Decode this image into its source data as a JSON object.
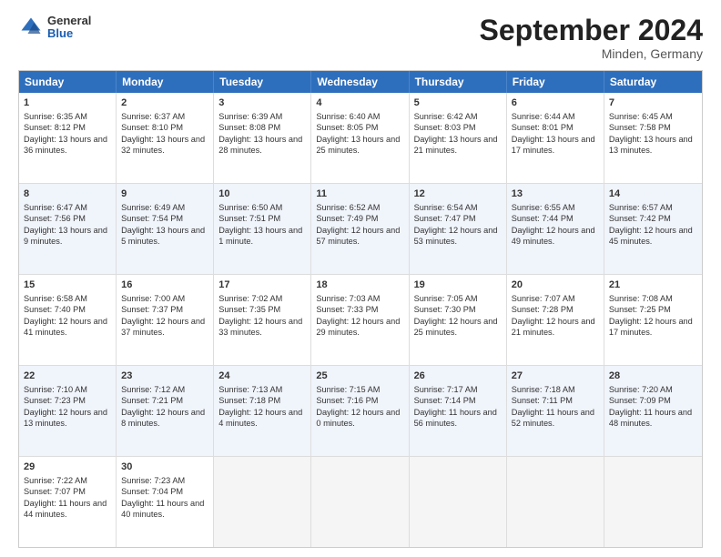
{
  "header": {
    "logo": {
      "general": "General",
      "blue": "Blue"
    },
    "title": "September 2024",
    "location": "Minden, Germany"
  },
  "calendar": {
    "days": [
      "Sunday",
      "Monday",
      "Tuesday",
      "Wednesday",
      "Thursday",
      "Friday",
      "Saturday"
    ],
    "rows": [
      [
        {
          "day": "1",
          "sunrise": "Sunrise: 6:35 AM",
          "sunset": "Sunset: 8:12 PM",
          "daylight": "Daylight: 13 hours and 36 minutes."
        },
        {
          "day": "2",
          "sunrise": "Sunrise: 6:37 AM",
          "sunset": "Sunset: 8:10 PM",
          "daylight": "Daylight: 13 hours and 32 minutes."
        },
        {
          "day": "3",
          "sunrise": "Sunrise: 6:39 AM",
          "sunset": "Sunset: 8:08 PM",
          "daylight": "Daylight: 13 hours and 28 minutes."
        },
        {
          "day": "4",
          "sunrise": "Sunrise: 6:40 AM",
          "sunset": "Sunset: 8:05 PM",
          "daylight": "Daylight: 13 hours and 25 minutes."
        },
        {
          "day": "5",
          "sunrise": "Sunrise: 6:42 AM",
          "sunset": "Sunset: 8:03 PM",
          "daylight": "Daylight: 13 hours and 21 minutes."
        },
        {
          "day": "6",
          "sunrise": "Sunrise: 6:44 AM",
          "sunset": "Sunset: 8:01 PM",
          "daylight": "Daylight: 13 hours and 17 minutes."
        },
        {
          "day": "7",
          "sunrise": "Sunrise: 6:45 AM",
          "sunset": "Sunset: 7:58 PM",
          "daylight": "Daylight: 13 hours and 13 minutes."
        }
      ],
      [
        {
          "day": "8",
          "sunrise": "Sunrise: 6:47 AM",
          "sunset": "Sunset: 7:56 PM",
          "daylight": "Daylight: 13 hours and 9 minutes."
        },
        {
          "day": "9",
          "sunrise": "Sunrise: 6:49 AM",
          "sunset": "Sunset: 7:54 PM",
          "daylight": "Daylight: 13 hours and 5 minutes."
        },
        {
          "day": "10",
          "sunrise": "Sunrise: 6:50 AM",
          "sunset": "Sunset: 7:51 PM",
          "daylight": "Daylight: 13 hours and 1 minute."
        },
        {
          "day": "11",
          "sunrise": "Sunrise: 6:52 AM",
          "sunset": "Sunset: 7:49 PM",
          "daylight": "Daylight: 12 hours and 57 minutes."
        },
        {
          "day": "12",
          "sunrise": "Sunrise: 6:54 AM",
          "sunset": "Sunset: 7:47 PM",
          "daylight": "Daylight: 12 hours and 53 minutes."
        },
        {
          "day": "13",
          "sunrise": "Sunrise: 6:55 AM",
          "sunset": "Sunset: 7:44 PM",
          "daylight": "Daylight: 12 hours and 49 minutes."
        },
        {
          "day": "14",
          "sunrise": "Sunrise: 6:57 AM",
          "sunset": "Sunset: 7:42 PM",
          "daylight": "Daylight: 12 hours and 45 minutes."
        }
      ],
      [
        {
          "day": "15",
          "sunrise": "Sunrise: 6:58 AM",
          "sunset": "Sunset: 7:40 PM",
          "daylight": "Daylight: 12 hours and 41 minutes."
        },
        {
          "day": "16",
          "sunrise": "Sunrise: 7:00 AM",
          "sunset": "Sunset: 7:37 PM",
          "daylight": "Daylight: 12 hours and 37 minutes."
        },
        {
          "day": "17",
          "sunrise": "Sunrise: 7:02 AM",
          "sunset": "Sunset: 7:35 PM",
          "daylight": "Daylight: 12 hours and 33 minutes."
        },
        {
          "day": "18",
          "sunrise": "Sunrise: 7:03 AM",
          "sunset": "Sunset: 7:33 PM",
          "daylight": "Daylight: 12 hours and 29 minutes."
        },
        {
          "day": "19",
          "sunrise": "Sunrise: 7:05 AM",
          "sunset": "Sunset: 7:30 PM",
          "daylight": "Daylight: 12 hours and 25 minutes."
        },
        {
          "day": "20",
          "sunrise": "Sunrise: 7:07 AM",
          "sunset": "Sunset: 7:28 PM",
          "daylight": "Daylight: 12 hours and 21 minutes."
        },
        {
          "day": "21",
          "sunrise": "Sunrise: 7:08 AM",
          "sunset": "Sunset: 7:25 PM",
          "daylight": "Daylight: 12 hours and 17 minutes."
        }
      ],
      [
        {
          "day": "22",
          "sunrise": "Sunrise: 7:10 AM",
          "sunset": "Sunset: 7:23 PM",
          "daylight": "Daylight: 12 hours and 13 minutes."
        },
        {
          "day": "23",
          "sunrise": "Sunrise: 7:12 AM",
          "sunset": "Sunset: 7:21 PM",
          "daylight": "Daylight: 12 hours and 8 minutes."
        },
        {
          "day": "24",
          "sunrise": "Sunrise: 7:13 AM",
          "sunset": "Sunset: 7:18 PM",
          "daylight": "Daylight: 12 hours and 4 minutes."
        },
        {
          "day": "25",
          "sunrise": "Sunrise: 7:15 AM",
          "sunset": "Sunset: 7:16 PM",
          "daylight": "Daylight: 12 hours and 0 minutes."
        },
        {
          "day": "26",
          "sunrise": "Sunrise: 7:17 AM",
          "sunset": "Sunset: 7:14 PM",
          "daylight": "Daylight: 11 hours and 56 minutes."
        },
        {
          "day": "27",
          "sunrise": "Sunrise: 7:18 AM",
          "sunset": "Sunset: 7:11 PM",
          "daylight": "Daylight: 11 hours and 52 minutes."
        },
        {
          "day": "28",
          "sunrise": "Sunrise: 7:20 AM",
          "sunset": "Sunset: 7:09 PM",
          "daylight": "Daylight: 11 hours and 48 minutes."
        }
      ],
      [
        {
          "day": "29",
          "sunrise": "Sunrise: 7:22 AM",
          "sunset": "Sunset: 7:07 PM",
          "daylight": "Daylight: 11 hours and 44 minutes."
        },
        {
          "day": "30",
          "sunrise": "Sunrise: 7:23 AM",
          "sunset": "Sunset: 7:04 PM",
          "daylight": "Daylight: 11 hours and 40 minutes."
        },
        {
          "day": "",
          "sunrise": "",
          "sunset": "",
          "daylight": ""
        },
        {
          "day": "",
          "sunrise": "",
          "sunset": "",
          "daylight": ""
        },
        {
          "day": "",
          "sunrise": "",
          "sunset": "",
          "daylight": ""
        },
        {
          "day": "",
          "sunrise": "",
          "sunset": "",
          "daylight": ""
        },
        {
          "day": "",
          "sunrise": "",
          "sunset": "",
          "daylight": ""
        }
      ]
    ]
  }
}
